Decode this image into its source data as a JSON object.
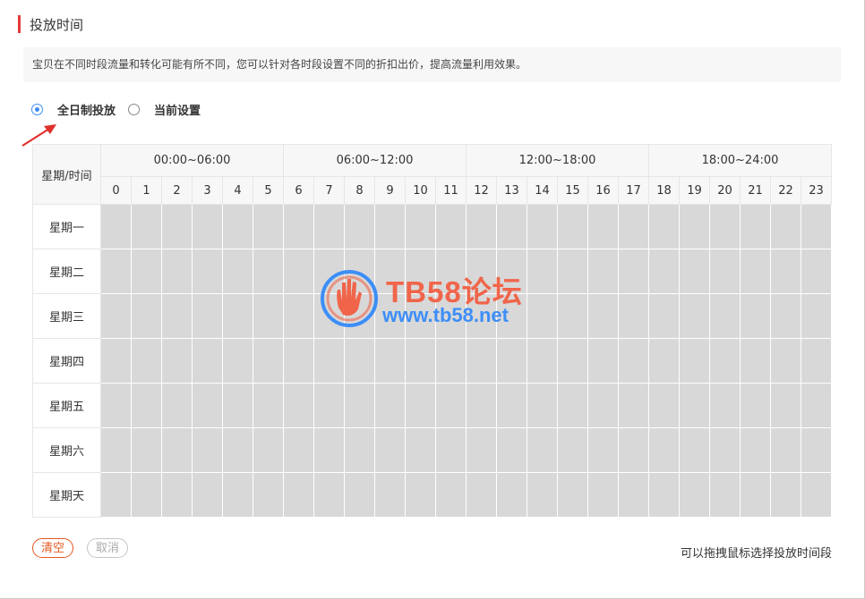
{
  "section": {
    "title": "投放时间"
  },
  "tip": "宝贝在不同时段流量和转化可能有所不同，您可以针对各时段设置不同的折扣出价，提高流量利用效果。",
  "mode": {
    "options": [
      {
        "label": "全日制投放",
        "checked": true
      },
      {
        "label": "当前设置",
        "checked": false
      }
    ]
  },
  "grid": {
    "corner_label": "星期/时间",
    "ranges": [
      "00:00~06:00",
      "06:00~12:00",
      "12:00~18:00",
      "18:00~24:00"
    ],
    "hours": [
      "0",
      "1",
      "2",
      "3",
      "4",
      "5",
      "6",
      "7",
      "8",
      "9",
      "10",
      "11",
      "12",
      "13",
      "14",
      "15",
      "16",
      "17",
      "18",
      "19",
      "20",
      "21",
      "22",
      "23"
    ],
    "days": [
      "星期一",
      "星期二",
      "星期三",
      "星期四",
      "星期五",
      "星期六",
      "星期天"
    ],
    "slot_color": "#d8d8d8"
  },
  "buttons": {
    "clear": "清空",
    "cancel": "取消"
  },
  "hint": "可以拖拽鼠标选择投放时间段",
  "watermark": {
    "title": "TB58论坛",
    "url": "www.tb58.net"
  },
  "colors": {
    "accent_red": "#e4393c",
    "radio_blue": "#3d8ef7",
    "clear_orange": "#e4561c"
  }
}
